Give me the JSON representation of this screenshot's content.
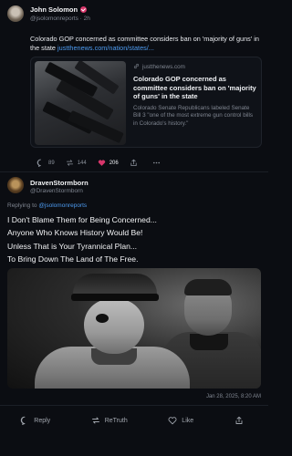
{
  "quoted_post": {
    "author_name": "John Solomon",
    "handle_time": "@jsolomonreports · 2h",
    "text_before_link": "Colorado GOP concerned as committee considers ban on 'majority of guns' in the state ",
    "link_text": "justthenews.com/nation/states/...",
    "card": {
      "domain": "justthenews.com",
      "title": "Colorado GOP concerned as committee considers ban on 'majority of guns' in the state",
      "description": "Colorado Senate Republicans labeled Senate Bill 3 \"one of the most extreme gun control bills in Colorado's history.\""
    },
    "actions": {
      "replies": "89",
      "reposts": "144",
      "likes": "206"
    }
  },
  "reply_post": {
    "author_name": "DravenStormborn",
    "handle": "@DravenStormborn",
    "replying_prefix": "Replying to ",
    "replying_to": "@jsolomonreports",
    "lines": [
      "I Don't Blame Them for Being Concerned...",
      "Anyone Who Knows History Would Be!",
      "Unless That is Your Tyrannical Plan...",
      "To Bring Down The Land of The Free."
    ],
    "timestamp": "Jan 28, 2025, 8:20 AM",
    "actions": {
      "reply": "Reply",
      "retruth": "ReTruth",
      "like": "Like"
    }
  },
  "colors": {
    "background": "#0b0d12",
    "link": "#4d9bf0",
    "like": "#d9366b",
    "muted": "#7f8590"
  }
}
